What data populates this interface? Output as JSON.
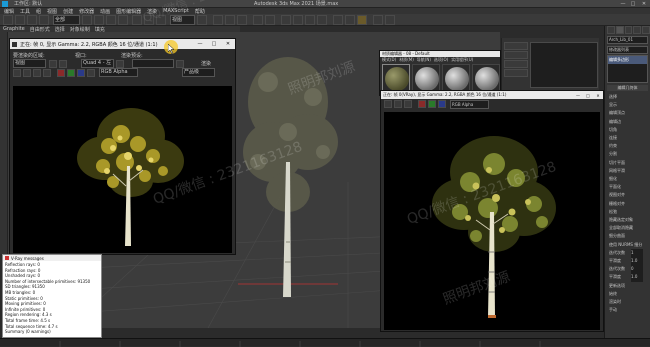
{
  "app": {
    "title": "Autodesk 3ds Max  2021  场景.max",
    "workspace": "工作区: 默认"
  },
  "menubar": {
    "items": [
      "编辑",
      "工具",
      "组",
      "视图",
      "创建",
      "修改器",
      "动画",
      "图形编辑器",
      "渲染",
      "MAXScript",
      "帮助"
    ]
  },
  "main_toolbar": {
    "selection_filter": "全部",
    "view_dropdown": "视图"
  },
  "ribbon_tabs": [
    "Graphite",
    "自由形式",
    "选择",
    "对象绘制",
    "填充"
  ],
  "left_vfb": {
    "title": "正在: 帧 0, 显示 Gamma: 2.2, RGBA 颜色 16 位/通道 (1:1)",
    "label_area": "要渲染的区域:",
    "label_viewport": "视口:",
    "label_preset": "渲染预设:",
    "area_value": "视图",
    "viewport_value": "Quad 4 - 左",
    "render_btn": "渲染",
    "preset_value": "产品级",
    "channel": "RGB Alpha"
  },
  "vray_log": {
    "title": "V-Ray messages",
    "lines": [
      "Reflection rays: 0",
      "Refraction rays: 0",
      "Unshaded rays: 0",
      "Number of intersectable primitives: 91350",
      "SD triangles: 91350",
      "MB triangles: 0",
      "Static primitives: 0",
      "Moving primitives: 0",
      "Infinite primitives: 0",
      "Region rendering: 4.3 s",
      "Total frame time: 4.5 s",
      "Total sequence time: 4.7 s",
      "Summary (0 warnings)"
    ]
  },
  "material_editor": {
    "title": "材质编辑器 - 08 - Default",
    "menu": [
      "模式(D)",
      "材质(M)",
      "导航(N)",
      "选项(O)",
      "实用程序(U)"
    ]
  },
  "right_vfb": {
    "title": "正在: 帧 0(VRay), 显示 Gamma: 2.2, RGBA 颜色 16 位/通道 (1:1)",
    "channel": "RGB Alpha"
  },
  "command_panel": {
    "object_name": "Arch_Lib_01",
    "modifier_list": "修改器列表",
    "modifier_stack_item": "编辑多边形",
    "rollout_title": "编辑几何体",
    "options": [
      "选择",
      "显示",
      "编辑顶点",
      "编辑边",
      "切角",
      "连接",
      "约束",
      "分割",
      "切片平面",
      "网格平滑",
      "细化",
      "平面化",
      "视图对齐",
      "栅格对齐",
      "松弛",
      "隐藏选定对象",
      "全部取消隐藏",
      "细分曲面",
      "使用 NURMS 细分",
      "迭代次数",
      "平滑度",
      "迭代次数",
      "平滑度",
      "更新选项",
      "始终",
      "渲染时",
      "手动"
    ],
    "spinners": {
      "iterations": "1",
      "smoothness": "1.0",
      "render_iterations": "0",
      "render_smoothness": "1.0"
    }
  },
  "watermarks": [
    "QQ/微信 : 2321163128",
    "照明邦刘源"
  ],
  "colors": {
    "accent": "#f5a623",
    "window_bar": "#e9e9e9",
    "ui_dark": "#2b2b2b",
    "vfb_bg": "#000000",
    "viewport_bg": "#3c3c3c"
  }
}
